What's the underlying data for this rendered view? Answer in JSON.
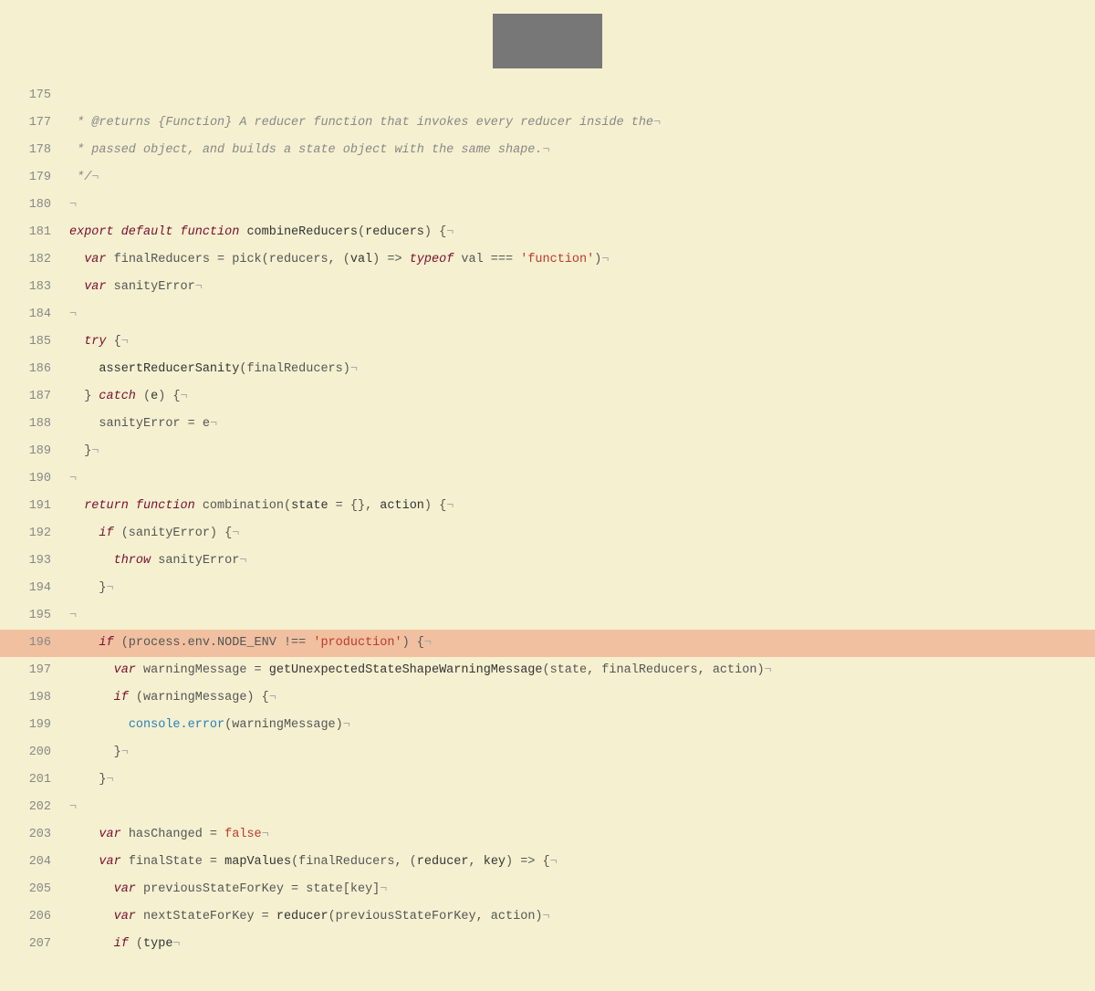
{
  "editor": {
    "background": "#f5f0d0",
    "lines": [
      {
        "num": 175,
        "content": "",
        "tokens": []
      },
      {
        "num": 177,
        "content": " * @returns {Function} A reducer function that invokes every reducer inside the¬",
        "tokens": "comment"
      },
      {
        "num": 178,
        "content": " * passed object, and builds a state object with the same shape.¬",
        "tokens": "comment"
      },
      {
        "num": 179,
        "content": " */¬",
        "tokens": "comment"
      },
      {
        "num": 180,
        "content": "¬",
        "tokens": "plain"
      },
      {
        "num": 181,
        "content": "export default function combineReducers(reducers) {¬",
        "tokens": "mixed"
      },
      {
        "num": 182,
        "content": "  var finalReducers = pick(reducers, (val) => typeof val === 'function')¬",
        "tokens": "mixed"
      },
      {
        "num": 183,
        "content": "  var sanityError¬",
        "tokens": "mixed"
      },
      {
        "num": 184,
        "content": "¬",
        "tokens": "plain"
      },
      {
        "num": 185,
        "content": "  try {¬",
        "tokens": "mixed"
      },
      {
        "num": 186,
        "content": "    assertReducerSanity(finalReducers)¬",
        "tokens": "mixed"
      },
      {
        "num": 187,
        "content": "  } catch (e) {¬",
        "tokens": "mixed"
      },
      {
        "num": 188,
        "content": "    sanityError = e¬",
        "tokens": "mixed"
      },
      {
        "num": 189,
        "content": "  }¬",
        "tokens": "plain"
      },
      {
        "num": 190,
        "content": "¬",
        "tokens": "plain"
      },
      {
        "num": 191,
        "content": "  return function combination(state = {}, action) {¬",
        "tokens": "mixed"
      },
      {
        "num": 192,
        "content": "    if (sanityError) {¬",
        "tokens": "mixed"
      },
      {
        "num": 193,
        "content": "      throw sanityError¬",
        "tokens": "mixed"
      },
      {
        "num": 194,
        "content": "    }¬",
        "tokens": "plain"
      },
      {
        "num": 195,
        "content": "¬",
        "tokens": "plain"
      },
      {
        "num": 196,
        "content": "    if (process.env.NODE_ENV !== 'production') {¬",
        "tokens": "mixed",
        "highlighted": true
      },
      {
        "num": 197,
        "content": "      var warningMessage = getUnexpectedStateShapeWarningMessage(state, finalReducers, action)¬",
        "tokens": "mixed"
      },
      {
        "num": 198,
        "content": "      if (warningMessage) {¬",
        "tokens": "mixed"
      },
      {
        "num": 199,
        "content": "        console.error(warningMessage)¬",
        "tokens": "mixed"
      },
      {
        "num": 200,
        "content": "      }¬",
        "tokens": "plain"
      },
      {
        "num": 201,
        "content": "    }¬",
        "tokens": "plain"
      },
      {
        "num": 202,
        "content": "¬",
        "tokens": "plain"
      },
      {
        "num": 203,
        "content": "    var hasChanged = false¬",
        "tokens": "mixed"
      },
      {
        "num": 204,
        "content": "    var finalState = mapValues(finalReducers, (reducer, key) => {¬",
        "tokens": "mixed"
      },
      {
        "num": 205,
        "content": "      var previousStateForKey = state[key]¬",
        "tokens": "mixed"
      },
      {
        "num": 206,
        "content": "      var nextStateForKey = reducer(previousStateForKey, action)¬",
        "tokens": "mixed"
      },
      {
        "num": 207,
        "content": "      if (type¬",
        "tokens": "mixed"
      }
    ]
  }
}
